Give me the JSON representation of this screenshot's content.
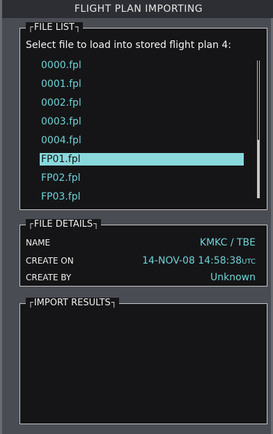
{
  "window": {
    "title": "FLIGHT PLAN IMPORTING"
  },
  "file_list": {
    "label": "FILE LIST",
    "instruction": "Select file to load into stored flight plan 4:",
    "files": [
      "0000.fpl",
      "0001.fpl",
      "0002.fpl",
      "0003.fpl",
      "0004.fpl",
      "FP01.fpl",
      "FP02.fpl",
      "FP03.fpl"
    ],
    "selected_index": 5
  },
  "file_details": {
    "label": "FILE DETAILS",
    "rows": [
      {
        "label": "NAME",
        "value": "KMKC / TBE"
      },
      {
        "label": "CREATE ON",
        "value": "14-NOV-08 14:58:38",
        "suffix": "UTC"
      },
      {
        "label": "CREATE BY",
        "value": "Unknown"
      }
    ]
  },
  "import_results": {
    "label": "IMPORT RESULTS"
  },
  "colors": {
    "background": "#4a4c53",
    "panel": "#151517",
    "cyan": "#6fd3d8",
    "highlight": "#89d8dc"
  }
}
